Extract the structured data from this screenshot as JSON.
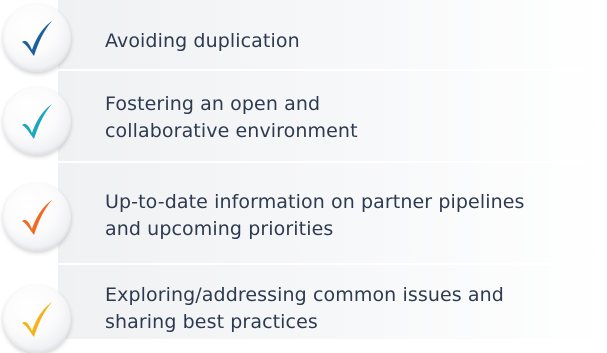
{
  "items": [
    {
      "text": "Avoiding duplication",
      "check_color": "#1d5f9e",
      "icon": "checkmark-icon"
    },
    {
      "text": "Fostering an open and\ncollaborative environment",
      "check_color": "#1aa7c2",
      "icon": "checkmark-icon"
    },
    {
      "text": "Up-to-date information on partner pipelines\nand upcoming priorities",
      "check_color": "#ef6a22",
      "icon": "checkmark-icon"
    },
    {
      "text": "Exploring/addressing common issues and\nsharing best practices",
      "check_color": "#f3b41b",
      "icon": "checkmark-icon"
    }
  ]
}
